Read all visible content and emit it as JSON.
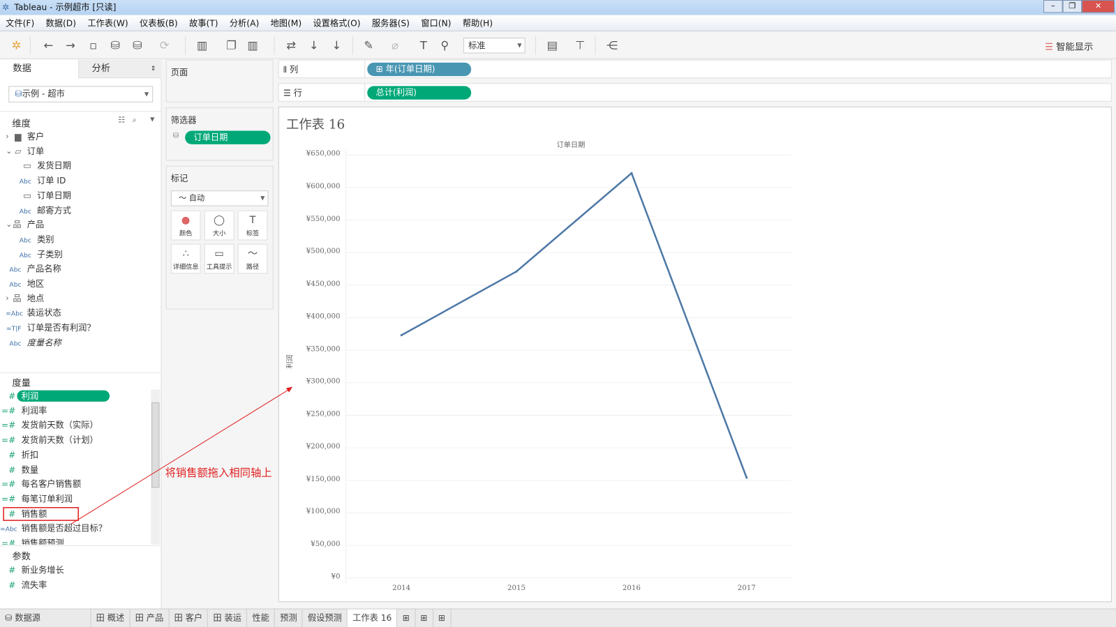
{
  "window": {
    "title": "Tableau - 示例超市 [只读]"
  },
  "menu": [
    "文件(F)",
    "数据(D)",
    "工作表(W)",
    "仪表板(B)",
    "故事(T)",
    "分析(A)",
    "地图(M)",
    "设置格式(O)",
    "服务器(S)",
    "窗口(N)",
    "帮助(H)"
  ],
  "toolbar": {
    "fit_select": "标准",
    "show_me": "智能显示"
  },
  "left": {
    "tab_data": "数据",
    "tab_analysis": "分析",
    "datasource": "示例 - 超市",
    "dimensions_title": "维度",
    "dimensions": [
      {
        "type": "folder",
        "label": "客户",
        "indent": 0,
        "expand": "›"
      },
      {
        "type": "folder-open",
        "label": "订单",
        "indent": 0,
        "expand": "⌄"
      },
      {
        "type": "date",
        "label": "发货日期",
        "indent": 1
      },
      {
        "type": "Abc",
        "label": "订单 ID",
        "indent": 1
      },
      {
        "type": "date",
        "label": "订单日期",
        "indent": 1
      },
      {
        "type": "Abc",
        "label": "邮寄方式",
        "indent": 1
      },
      {
        "type": "hier",
        "label": "产品",
        "indent": 0,
        "expand": "⌄"
      },
      {
        "type": "Abc",
        "label": "类别",
        "indent": 1
      },
      {
        "type": "Abc",
        "label": "子类别",
        "indent": 1
      },
      {
        "type": "Abc",
        "label": "产品名称",
        "indent": 0
      },
      {
        "type": "Abc",
        "label": "地区",
        "indent": 0
      },
      {
        "type": "hier",
        "label": "地点",
        "indent": 0,
        "expand": "›"
      },
      {
        "type": "=Abc",
        "label": "装运状态",
        "indent": 0
      },
      {
        "type": "=T|F",
        "label": "订单是否有利润？",
        "indent": 0
      },
      {
        "type": "Abc",
        "label": "度量名称",
        "indent": 0,
        "italic": true
      }
    ],
    "measures_title": "度量",
    "measures": [
      {
        "type": "#",
        "label": "利润",
        "selected": true
      },
      {
        "type": "=#",
        "label": "利润率"
      },
      {
        "type": "=#",
        "label": "发货前天数（实际）"
      },
      {
        "type": "=#",
        "label": "发货前天数（计划）"
      },
      {
        "type": "#",
        "label": "折扣"
      },
      {
        "type": "#",
        "label": "数量"
      },
      {
        "type": "=#",
        "label": "每名客户销售额"
      },
      {
        "type": "=#",
        "label": "每笔订单利润"
      },
      {
        "type": "#",
        "label": "销售额",
        "highlighted": true
      },
      {
        "type": "=Abc",
        "label": "销售额是否超过目标？"
      },
      {
        "type": "=#",
        "label": "销售额预测"
      }
    ],
    "params_title": "参数",
    "params": [
      {
        "type": "#",
        "label": "新业务增长"
      },
      {
        "type": "#",
        "label": "流失率"
      }
    ]
  },
  "cards": {
    "pages": "页面",
    "filters": "筛选器",
    "filter_pill": "订单日期",
    "marks": "标记",
    "mark_type": "自动",
    "mark_buttons": [
      "颜色",
      "大小",
      "标签",
      "详细信息",
      "工具提示",
      "路径"
    ]
  },
  "shelves": {
    "columns_label": "列",
    "columns_pill": "年(订单日期)",
    "rows_label": "行",
    "rows_pill": "总计(利润)"
  },
  "annotation": {
    "text": "将销售额拖入相同轴上",
    "color": "#e02020"
  },
  "sheet_title": "工作表  16",
  "chart_data": {
    "type": "line",
    "title": "",
    "header": "订单日期",
    "xlabel": "",
    "ylabel": "利润",
    "categories": [
      "2014",
      "2015",
      "2016",
      "2017"
    ],
    "values": [
      373000,
      471000,
      622000,
      154000
    ],
    "ylim": [
      0,
      650000
    ],
    "yticks": [
      "¥650,000",
      "¥600,000",
      "¥550,000",
      "¥500,000",
      "¥450,000",
      "¥400,000",
      "¥350,000",
      "¥300,000",
      "¥250,000",
      "¥200,000",
      "¥150,000",
      "¥100,000",
      "¥50,000",
      "¥0"
    ],
    "grid": true,
    "color": "#4e79a7"
  },
  "bottom_tabs": {
    "datasource": "数据源",
    "sheets": [
      "田 概述",
      "田 产品",
      "田 客户",
      "田 装运",
      "性能",
      "预测",
      "假设预测",
      "工作表 16"
    ],
    "active": "工作表 16"
  }
}
